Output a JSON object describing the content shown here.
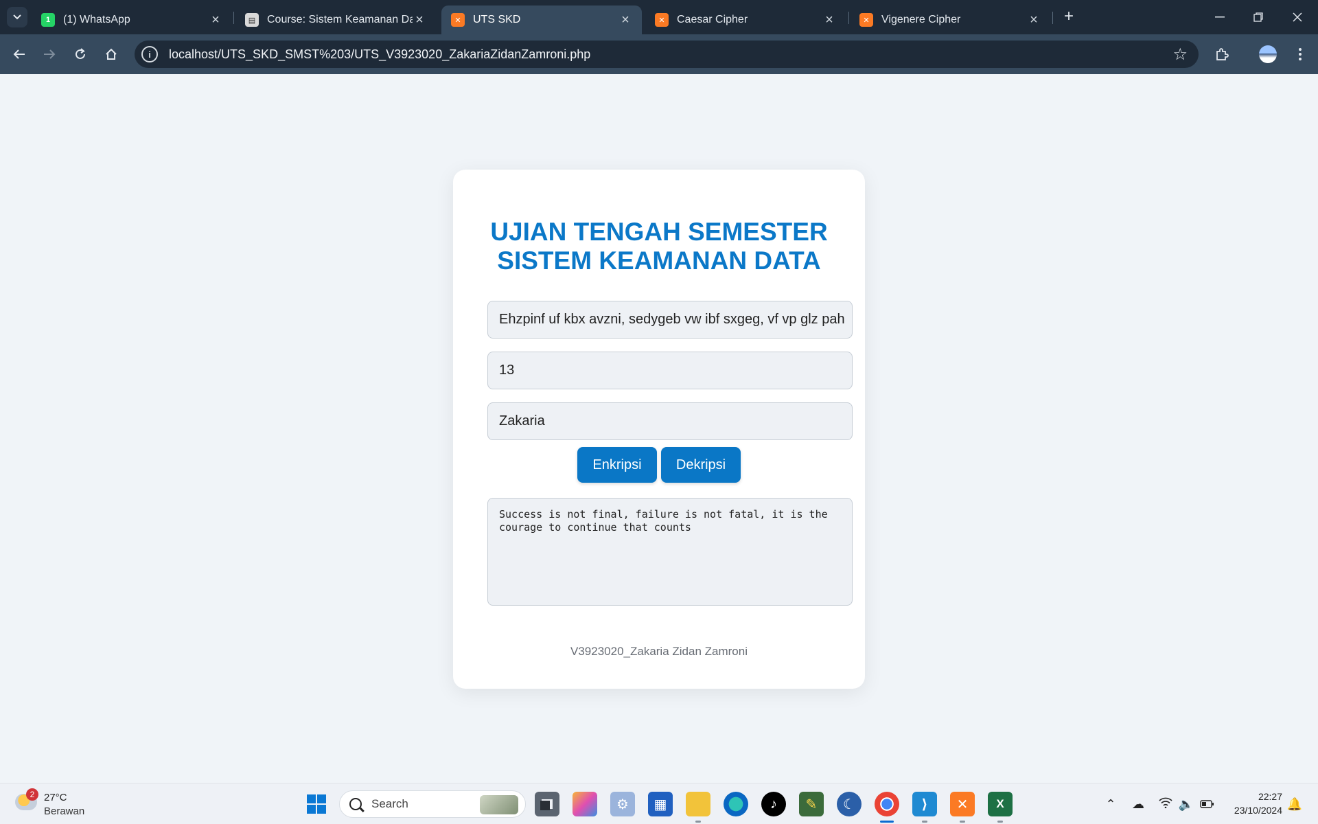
{
  "browser": {
    "tabs": [
      {
        "title": "(1) WhatsApp",
        "favicon": "whatsapp-icon",
        "active": false
      },
      {
        "title": "Course: Sistem Keamanan Data",
        "favicon": "course-icon",
        "active": false
      },
      {
        "title": "UTS SKD",
        "favicon": "xampp-icon",
        "active": true
      },
      {
        "title": "Caesar Cipher",
        "favicon": "xampp-icon",
        "active": false
      },
      {
        "title": "Vigenere Cipher",
        "favicon": "xampp-icon",
        "active": false
      }
    ],
    "url": "localhost/UTS_SKD_SMST%203/UTS_V3923020_ZakariaZidanZamroni.php"
  },
  "card": {
    "title_line1": "UJIAN TENGAH SEMESTER",
    "title_line2": "SISTEM KEAMANAN DATA",
    "text_input_value": "Ehzpinf uf kbx avzni, sedygeb vw ibf sxgeg, vf vp glz pah",
    "shift_input_value": "13",
    "key_input_value": "Zakaria",
    "encrypt_label": "Enkripsi",
    "decrypt_label": "Dekripsi",
    "output_text": "Success is not final, failure is not fatal, it is the courage to continue that counts",
    "footer": "V3923020_Zakaria Zidan Zamroni",
    "accent_color": "#0b78c8",
    "button_color": "#0a77c6"
  },
  "taskbar": {
    "weather_temp": "27°C",
    "weather_condition": "Berawan",
    "weather_badge": "2",
    "search_label": "Search",
    "time": "22:27",
    "date": "23/10/2024"
  }
}
